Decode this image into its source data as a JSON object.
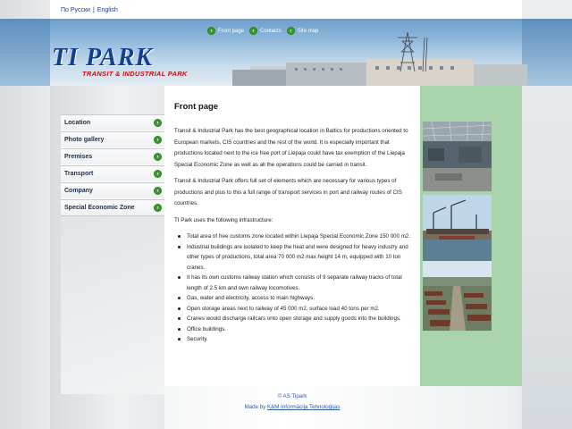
{
  "languages": [
    {
      "label": "По Русски"
    },
    {
      "label": "English"
    }
  ],
  "top_nav": [
    {
      "label": "Front page"
    },
    {
      "label": "Contacts"
    },
    {
      "label": "Site map"
    }
  ],
  "logo": {
    "main": "TI PARK",
    "sub": "TRANSIT & INDUSTRIAL PARK"
  },
  "menu": [
    {
      "label": "Location"
    },
    {
      "label": "Photo gallery"
    },
    {
      "label": "Premises"
    },
    {
      "label": "Transport"
    },
    {
      "label": "Company"
    },
    {
      "label": "Special Economic Zone"
    }
  ],
  "content": {
    "title": "Front page",
    "paragraphs": [
      "Transit & Industrial Park has the best geographical location in Baltics for productions oriented to European markets, CIS countries and the rest of the world. It is especially important that productions located next to the ice free port of Liepaja could have tax exemption of the Liepaja Special Economic Zone as well as all the operations could be carried in transit.",
      "Transit & Industrial Park offers full set of elements which are necessary for various types of productions and plus to this a full range of transport services in port and railway routes of CIS countries.",
      "TI Park uses the following infrastructure:"
    ],
    "bullets": [
      "Total area of free customs zone located within Liepaja Special Economic Zone 150 000 m2.",
      "Industrial buildings are isolated to keep the heat and were designed for heavy industry and other types of productions, total area 70 000 m2 max height 14 m, equipped with 10 ton cranes.",
      "It has its own customs railway station which consists of 9 separate railway tracks of total length of 2.5 km and own railway locomotives.",
      "Gas, water and electricity, access to main highways.",
      "Open storage areas next to railway of 45 000 m2, surface load 40 tons per m2.",
      "Cranes would discharge railcars onto open storage and supply goods into the buildings.",
      "Office buildings.",
      "Security."
    ]
  },
  "footer": {
    "copyright": "© AS Tipark",
    "made_by_prefix": "Made by ",
    "made_by_link": "K&M Informācija Tehnoloģijas"
  },
  "colors": {
    "accent_green": "#3a9a2e",
    "brand_blue": "#123f8e",
    "photo_column": "#a9d3aa"
  }
}
